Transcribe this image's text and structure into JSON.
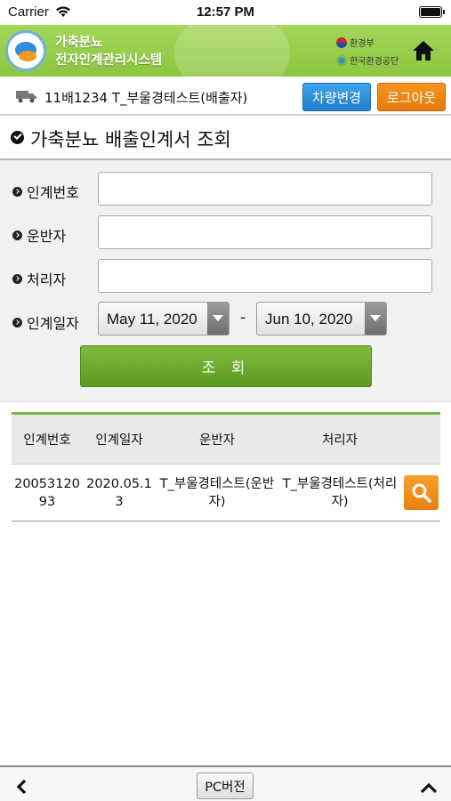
{
  "status_bar": {
    "carrier": "Carrier",
    "time": "12:57 PM"
  },
  "header": {
    "title_line1": "가축분뇨",
    "title_line2": "전자인계관리시스템",
    "org1": "환경부",
    "org2": "한국환경공단"
  },
  "user": {
    "info": "11배1234  T_부울경테스트(배출자)",
    "change_vehicle_label": "차량변경",
    "logout_label": "로그아웃"
  },
  "page": {
    "title": "가축분뇨 배출인계서 조회"
  },
  "search": {
    "transfer_no_label": "인계번호",
    "transfer_no_value": "",
    "carrier_label": "운반자",
    "carrier_value": "",
    "processor_label": "처리자",
    "processor_value": "",
    "date_label": "인계일자",
    "date_from": "May 11, 2020",
    "date_separator": "-",
    "date_to": "Jun 10, 2020",
    "search_button": "조 회"
  },
  "table": {
    "headers": {
      "transfer_no": "인계번호",
      "date": "인계일자",
      "carrier": "운반자",
      "processor": "처리자"
    },
    "rows": [
      {
        "transfer_no": "2005312093",
        "date": "2020.05.13",
        "carrier": "T_부울경테스트(운반자)",
        "processor": "T_부울경테스트(처리자)"
      }
    ]
  },
  "footer": {
    "pc_version_label": "PC버전"
  },
  "colors": {
    "header_green": "#8cc63f",
    "button_blue": "#1e7ec8",
    "button_orange": "#e57a0a",
    "search_green": "#5e9a22"
  }
}
